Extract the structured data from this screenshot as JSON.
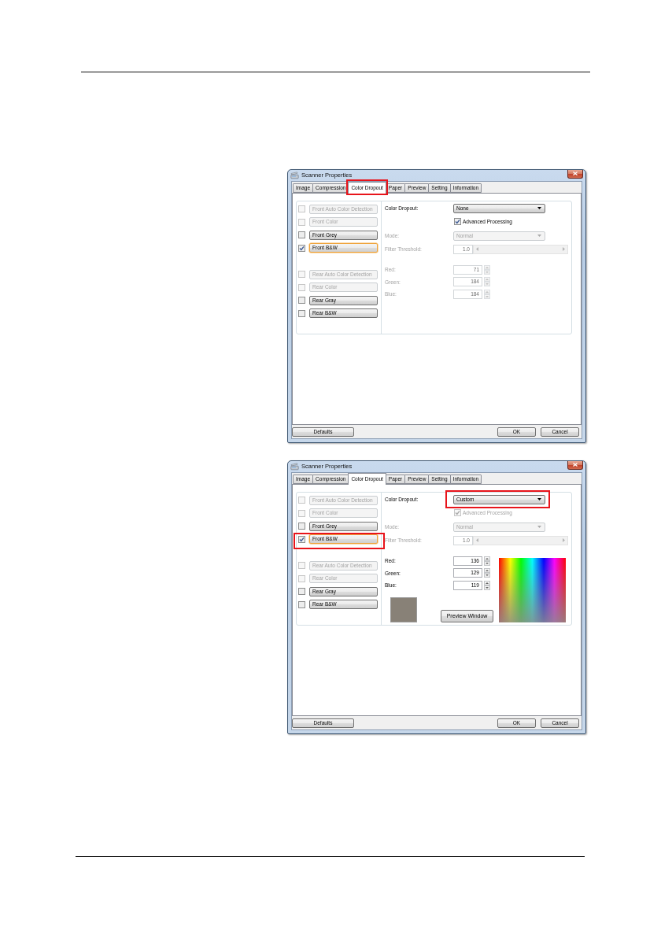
{
  "dialogs": [
    {
      "title": "Scanner Properties",
      "tabs": [
        {
          "label": "Image",
          "selected": false,
          "highlighted": false
        },
        {
          "label": "Compression",
          "selected": false,
          "highlighted": false
        },
        {
          "label": "Color Dropout",
          "selected": true,
          "highlighted": true
        },
        {
          "label": "Paper",
          "selected": false,
          "highlighted": false
        },
        {
          "label": "Preview",
          "selected": false,
          "highlighted": false
        },
        {
          "label": "Setting",
          "selected": false,
          "highlighted": false
        },
        {
          "label": "Information",
          "selected": false,
          "highlighted": false
        }
      ],
      "front_options": [
        {
          "label": "Front Auto Color Detection",
          "checked": false,
          "disabled": true,
          "focused": false,
          "highlighted": false
        },
        {
          "label": "Front Color",
          "checked": false,
          "disabled": true,
          "focused": false,
          "highlighted": false
        },
        {
          "label": "Front Grey",
          "checked": false,
          "disabled": false,
          "focused": false,
          "highlighted": false
        },
        {
          "label": "Front B&W",
          "checked": true,
          "disabled": false,
          "focused": true,
          "highlighted": false
        }
      ],
      "rear_options": [
        {
          "label": "Rear Auto Color Detection",
          "checked": false,
          "disabled": true,
          "focused": false,
          "highlighted": false
        },
        {
          "label": "Rear Color",
          "checked": false,
          "disabled": true,
          "focused": false,
          "highlighted": false
        },
        {
          "label": "Rear Gray",
          "checked": false,
          "disabled": false,
          "focused": false,
          "highlighted": false
        },
        {
          "label": "Rear B&W",
          "checked": false,
          "disabled": false,
          "focused": false,
          "highlighted": false
        }
      ],
      "color_dropout": {
        "label": "Color Dropout:",
        "value": "None",
        "highlighted": false
      },
      "advanced_processing": {
        "label": "Advanced Processing",
        "checked": true,
        "disabled": false
      },
      "mode": {
        "label": "Mode:",
        "value": "Normal",
        "disabled": true
      },
      "filter_threshold": {
        "label": "Filter Threshold:",
        "value": "1.0",
        "disabled": true
      },
      "channels": [
        {
          "label": "Red:",
          "value": "71",
          "disabled": true
        },
        {
          "label": "Green:",
          "value": "184",
          "disabled": true
        },
        {
          "label": "Blue:",
          "value": "184",
          "disabled": true
        }
      ],
      "buttons": [
        {
          "label": "Defaults"
        },
        {
          "label": "OK"
        },
        {
          "label": "Cancel"
        }
      ]
    },
    {
      "title": "Scanner Properties",
      "tabs": [
        {
          "label": "Image",
          "selected": false,
          "highlighted": false
        },
        {
          "label": "Compression",
          "selected": false,
          "highlighted": false
        },
        {
          "label": "Color Dropout",
          "selected": true,
          "highlighted": false
        },
        {
          "label": "Paper",
          "selected": false,
          "highlighted": false
        },
        {
          "label": "Preview",
          "selected": false,
          "highlighted": false
        },
        {
          "label": "Setting",
          "selected": false,
          "highlighted": false
        },
        {
          "label": "Information",
          "selected": false,
          "highlighted": false
        }
      ],
      "front_options": [
        {
          "label": "Front Auto Color Detection",
          "checked": false,
          "disabled": true,
          "focused": false,
          "highlighted": false
        },
        {
          "label": "Front Color",
          "checked": false,
          "disabled": true,
          "focused": false,
          "highlighted": false
        },
        {
          "label": "Front Grey",
          "checked": false,
          "disabled": false,
          "focused": false,
          "highlighted": false
        },
        {
          "label": "Front B&W",
          "checked": true,
          "disabled": false,
          "focused": true,
          "highlighted": true
        }
      ],
      "rear_options": [
        {
          "label": "Rear Auto Color Detection",
          "checked": false,
          "disabled": true,
          "focused": false,
          "highlighted": false
        },
        {
          "label": "Rear Color",
          "checked": false,
          "disabled": true,
          "focused": false,
          "highlighted": false
        },
        {
          "label": "Rear Gray",
          "checked": false,
          "disabled": false,
          "focused": false,
          "highlighted": false
        },
        {
          "label": "Rear B&W",
          "checked": false,
          "disabled": false,
          "focused": false,
          "highlighted": false
        }
      ],
      "color_dropout": {
        "label": "Color Dropout:",
        "value": "Custom",
        "highlighted": true
      },
      "advanced_processing": {
        "label": "Advanced Processing",
        "checked": true,
        "disabled": true
      },
      "mode": {
        "label": "Mode:",
        "value": "Normal",
        "disabled": true
      },
      "filter_threshold": {
        "label": "Filter Threshold:",
        "value": "1.0",
        "disabled": true
      },
      "channels": [
        {
          "label": "Red:",
          "value": "136",
          "disabled": false
        },
        {
          "label": "Green:",
          "value": "129",
          "disabled": false
        },
        {
          "label": "Blue:",
          "value": "119",
          "disabled": false
        }
      ],
      "color_picker": {
        "button": "Preview Window"
      },
      "buttons": [
        {
          "label": "Defaults"
        },
        {
          "label": "OK"
        },
        {
          "label": "Cancel"
        }
      ]
    }
  ]
}
